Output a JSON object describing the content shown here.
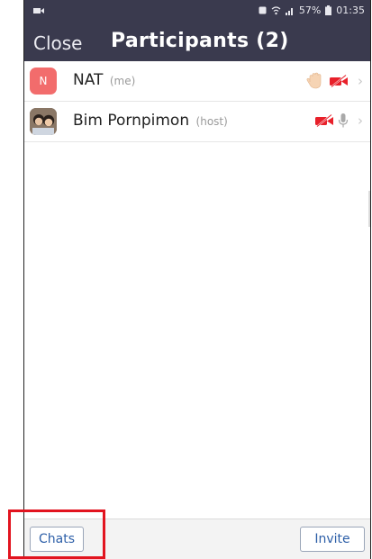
{
  "status_bar": {
    "battery": "57%",
    "time": "01:35"
  },
  "header": {
    "close_label": "Close",
    "title": "Participants (2)"
  },
  "participants": [
    {
      "avatar_letter": "N",
      "name": "NAT",
      "tag": "(me)"
    },
    {
      "name": "Bim Pornpimon",
      "tag": "(host)"
    }
  ],
  "footer": {
    "chats_label": "Chats",
    "invite_label": "Invite"
  },
  "colors": {
    "header_bg": "#3a3a4e",
    "mute_red": "#e8202a",
    "highlight": "#e2141f",
    "link_blue": "#2d5fa8"
  }
}
